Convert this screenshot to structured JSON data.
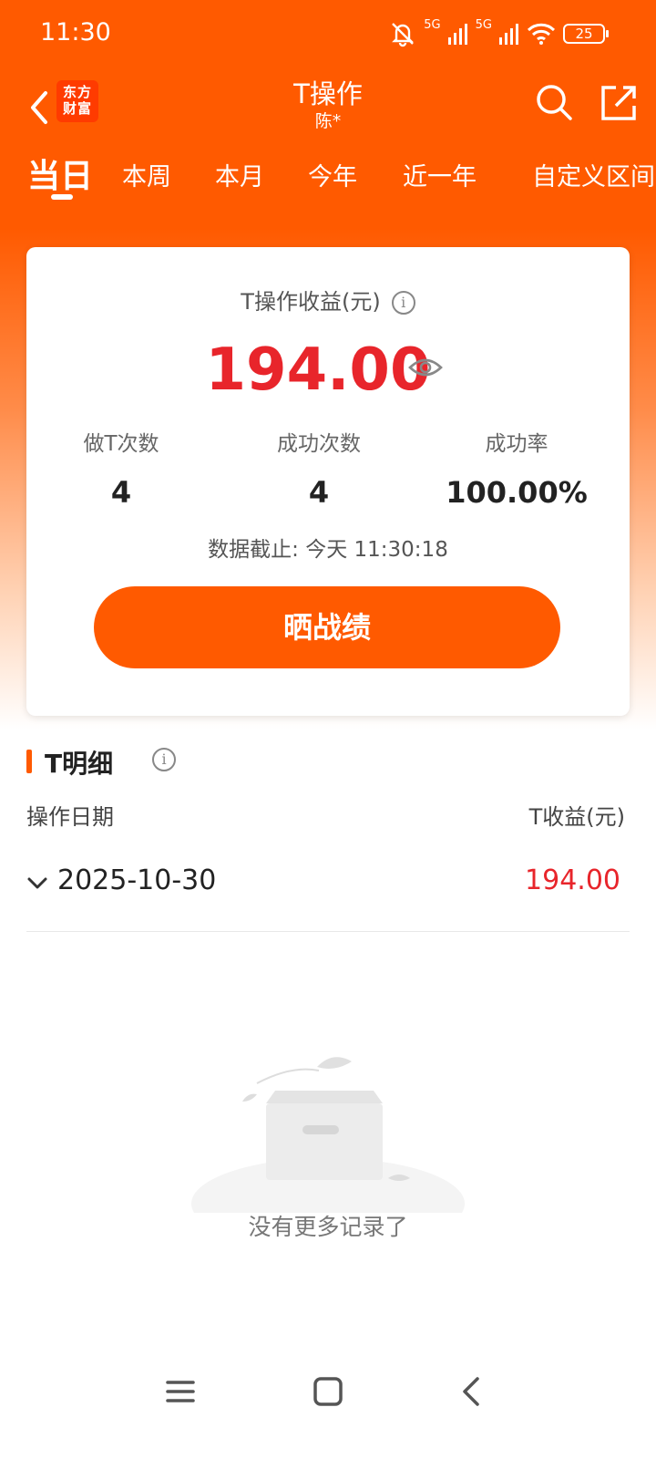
{
  "status_bar": {
    "time": "11:30",
    "network_1": "5G",
    "network_2": "5G",
    "battery": "25",
    "icons": [
      "mute-bell-icon",
      "signal-icon",
      "signal-icon",
      "wifi-icon",
      "battery-icon"
    ]
  },
  "nav": {
    "brand_line1": "东方",
    "brand_line2": "财富",
    "title": "T操作",
    "subtitle": "陈*",
    "icons": [
      "back-arrow-icon",
      "search-icon",
      "share-icon"
    ]
  },
  "tabs": [
    {
      "label": "当日",
      "active": true
    },
    {
      "label": "本周",
      "active": false
    },
    {
      "label": "本月",
      "active": false
    },
    {
      "label": "今年",
      "active": false
    },
    {
      "label": "近一年",
      "active": false
    },
    {
      "label": "自定义区间",
      "active": false
    }
  ],
  "summary": {
    "title": "T操作收益(元)",
    "profit": "194.00",
    "stats": [
      {
        "label": "做T次数",
        "value": "4"
      },
      {
        "label": "成功次数",
        "value": "4"
      },
      {
        "label": "成功率",
        "value": "100.00%"
      }
    ],
    "data_time": "数据截止: 今天 11:30:18",
    "share_button": "晒战绩"
  },
  "details": {
    "section_title": "T明细",
    "col_date": "操作日期",
    "col_profit": "T收益(元)",
    "rows": [
      {
        "date": "2025-10-30",
        "profit": "194.00"
      }
    ],
    "empty_text": "没有更多记录了"
  },
  "colors": {
    "brand_orange": "#ff5a00",
    "profit_red": "#e8252b"
  }
}
